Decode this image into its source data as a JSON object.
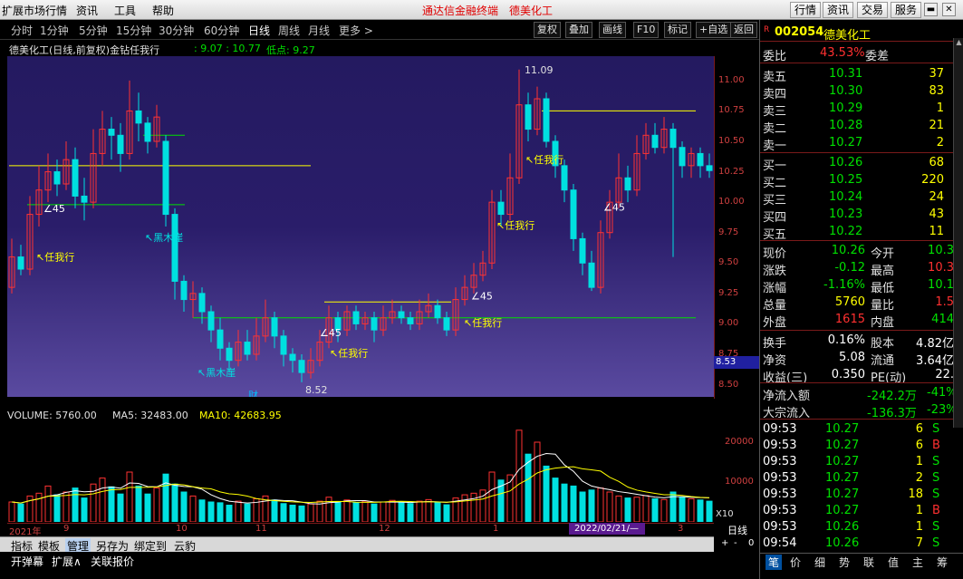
{
  "menubar": {
    "items": [
      "扩展市场行情",
      "资讯",
      "工具",
      "帮助"
    ],
    "app_title": "通达信金融终端",
    "stock_title": "德美化工",
    "right_buttons": [
      "行情",
      "资讯",
      "交易",
      "服务"
    ]
  },
  "periodbar": {
    "periods": [
      "分时",
      "1分钟",
      "5分钟",
      "15分钟",
      "30分钟",
      "60分钟",
      "日线",
      "周线",
      "月线",
      "更多 >"
    ],
    "active": "日线",
    "tools": [
      "复权",
      "叠加",
      "画线",
      "F10",
      "标记",
      "+自选",
      "返回"
    ]
  },
  "chart_header": {
    "title": "德美化工(日线,前复权)金钻任我行",
    "range": ": 9.07 : 10.77",
    "low_label": "低点: 9.27"
  },
  "main_chart_labels": {
    "high_tag": "11.09",
    "low_tag": "8.52",
    "cur_price": "8.53",
    "fin_mark": "财",
    "markers": [
      "任我行",
      "黑木崖",
      "任我行",
      "黑木崖",
      "任我行",
      "任我行",
      "任我行",
      "任我行"
    ],
    "angle45": [
      "45",
      "45",
      "45",
      "45"
    ]
  },
  "chart_data": {
    "type": "candlestick",
    "price_axis": {
      "ticks": [
        "11.00",
        "10.75",
        "10.50",
        "10.25",
        "10.00",
        "9.75",
        "9.50",
        "9.25",
        "9.00",
        "8.75",
        "8.50"
      ],
      "ylim": [
        8.4,
        11.2
      ]
    },
    "volume_axis": {
      "ticks": [
        "20000",
        "10000",
        "X10"
      ],
      "ylim": [
        0,
        25000
      ]
    },
    "date_ticks": [
      "2021年",
      "9",
      "10",
      "11",
      "12",
      "1",
      "3"
    ],
    "date_badge": "2022/02/21/—",
    "candles": [
      {
        "o": 9.3,
        "c": 9.55,
        "h": 9.7,
        "l": 9.25
      },
      {
        "o": 9.55,
        "c": 9.45,
        "h": 9.65,
        "l": 9.4
      },
      {
        "o": 9.45,
        "c": 9.9,
        "h": 10.05,
        "l": 9.4
      },
      {
        "o": 9.9,
        "c": 10.1,
        "h": 10.3,
        "l": 9.8
      },
      {
        "o": 10.1,
        "c": 10.25,
        "h": 10.4,
        "l": 10.0
      },
      {
        "o": 10.25,
        "c": 10.15,
        "h": 10.35,
        "l": 10.05
      },
      {
        "o": 10.15,
        "c": 10.35,
        "h": 10.5,
        "l": 10.1
      },
      {
        "o": 10.35,
        "c": 10.05,
        "h": 10.45,
        "l": 9.95
      },
      {
        "o": 10.05,
        "c": 10.0,
        "h": 10.2,
        "l": 9.85
      },
      {
        "o": 10.0,
        "c": 10.4,
        "h": 10.6,
        "l": 9.95
      },
      {
        "o": 10.4,
        "c": 10.6,
        "h": 10.75,
        "l": 10.3
      },
      {
        "o": 10.6,
        "c": 10.55,
        "h": 10.7,
        "l": 10.35
      },
      {
        "o": 10.55,
        "c": 10.4,
        "h": 10.65,
        "l": 10.25
      },
      {
        "o": 10.4,
        "c": 10.75,
        "h": 11.0,
        "l": 10.35
      },
      {
        "o": 10.75,
        "c": 10.65,
        "h": 10.9,
        "l": 10.5
      },
      {
        "o": 10.65,
        "c": 10.5,
        "h": 10.7,
        "l": 10.4
      },
      {
        "o": 10.5,
        "c": 10.7,
        "h": 10.8,
        "l": 10.45
      },
      {
        "o": 10.5,
        "c": 9.9,
        "h": 10.55,
        "l": 9.8
      },
      {
        "o": 9.9,
        "c": 9.35,
        "h": 9.95,
        "l": 9.2
      },
      {
        "o": 9.35,
        "c": 9.2,
        "h": 9.4,
        "l": 9.1
      },
      {
        "o": 9.2,
        "c": 9.25,
        "h": 9.35,
        "l": 9.05
      },
      {
        "o": 9.25,
        "c": 9.1,
        "h": 9.3,
        "l": 9.0
      },
      {
        "o": 9.1,
        "c": 8.95,
        "h": 9.15,
        "l": 8.85
      },
      {
        "o": 8.95,
        "c": 8.8,
        "h": 9.05,
        "l": 8.7
      },
      {
        "o": 8.8,
        "c": 8.7,
        "h": 8.85,
        "l": 8.6
      },
      {
        "o": 8.7,
        "c": 8.85,
        "h": 8.95,
        "l": 8.65
      },
      {
        "o": 8.85,
        "c": 8.75,
        "h": 8.95,
        "l": 8.7
      },
      {
        "o": 8.75,
        "c": 8.9,
        "h": 9.05,
        "l": 8.7
      },
      {
        "o": 8.9,
        "c": 9.05,
        "h": 9.2,
        "l": 8.85
      },
      {
        "o": 9.05,
        "c": 8.9,
        "h": 9.1,
        "l": 8.8
      },
      {
        "o": 8.9,
        "c": 8.75,
        "h": 8.95,
        "l": 8.65
      },
      {
        "o": 8.75,
        "c": 8.7,
        "h": 8.8,
        "l": 8.6
      },
      {
        "o": 8.7,
        "c": 8.6,
        "h": 8.75,
        "l": 8.52
      },
      {
        "o": 8.6,
        "c": 8.7,
        "h": 8.8,
        "l": 8.55
      },
      {
        "o": 8.7,
        "c": 8.85,
        "h": 8.95,
        "l": 8.65
      },
      {
        "o": 8.85,
        "c": 9.05,
        "h": 9.15,
        "l": 8.8
      },
      {
        "o": 9.05,
        "c": 8.95,
        "h": 9.1,
        "l": 8.85
      },
      {
        "o": 8.95,
        "c": 9.1,
        "h": 9.15,
        "l": 8.9
      },
      {
        "o": 9.1,
        "c": 9.0,
        "h": 9.15,
        "l": 8.95
      },
      {
        "o": 9.0,
        "c": 9.05,
        "h": 9.1,
        "l": 8.95
      },
      {
        "o": 9.05,
        "c": 8.95,
        "h": 9.1,
        "l": 8.85
      },
      {
        "o": 8.95,
        "c": 9.05,
        "h": 9.15,
        "l": 8.9
      },
      {
        "o": 9.05,
        "c": 9.1,
        "h": 9.2,
        "l": 9.0
      },
      {
        "o": 9.1,
        "c": 9.05,
        "h": 9.15,
        "l": 9.0
      },
      {
        "o": 9.05,
        "c": 9.0,
        "h": 9.1,
        "l": 8.95
      },
      {
        "o": 9.0,
        "c": 9.1,
        "h": 9.2,
        "l": 8.95
      },
      {
        "o": 9.1,
        "c": 9.15,
        "h": 9.25,
        "l": 9.05
      },
      {
        "o": 9.15,
        "c": 9.05,
        "h": 9.2,
        "l": 9.0
      },
      {
        "o": 9.05,
        "c": 8.95,
        "h": 9.1,
        "l": 8.9
      },
      {
        "o": 8.95,
        "c": 9.2,
        "h": 9.3,
        "l": 8.9
      },
      {
        "o": 9.2,
        "c": 9.3,
        "h": 9.4,
        "l": 9.15
      },
      {
        "o": 9.3,
        "c": 9.4,
        "h": 9.5,
        "l": 9.25
      },
      {
        "o": 9.4,
        "c": 9.5,
        "h": 9.6,
        "l": 9.35
      },
      {
        "o": 9.5,
        "c": 10.0,
        "h": 10.1,
        "l": 9.45
      },
      {
        "o": 10.0,
        "c": 9.9,
        "h": 10.1,
        "l": 9.8
      },
      {
        "o": 9.9,
        "c": 10.2,
        "h": 10.4,
        "l": 9.85
      },
      {
        "o": 10.2,
        "c": 10.8,
        "h": 11.09,
        "l": 10.15
      },
      {
        "o": 10.8,
        "c": 10.6,
        "h": 10.9,
        "l": 10.5
      },
      {
        "o": 10.6,
        "c": 10.85,
        "h": 10.95,
        "l": 10.55
      },
      {
        "o": 10.85,
        "c": 10.5,
        "h": 10.9,
        "l": 10.45
      },
      {
        "o": 10.5,
        "c": 10.3,
        "h": 10.55,
        "l": 10.2
      },
      {
        "o": 10.3,
        "c": 10.1,
        "h": 10.35,
        "l": 10.0
      },
      {
        "o": 10.1,
        "c": 9.7,
        "h": 10.15,
        "l": 9.6
      },
      {
        "o": 9.7,
        "c": 9.5,
        "h": 9.75,
        "l": 9.4
      },
      {
        "o": 9.5,
        "c": 9.3,
        "h": 9.6,
        "l": 9.27
      },
      {
        "o": 9.3,
        "c": 9.75,
        "h": 9.85,
        "l": 9.25
      },
      {
        "o": 9.75,
        "c": 10.0,
        "h": 10.1,
        "l": 9.7
      },
      {
        "o": 10.0,
        "c": 10.2,
        "h": 10.4,
        "l": 9.95
      },
      {
        "o": 10.2,
        "c": 10.1,
        "h": 10.3,
        "l": 10.0
      },
      {
        "o": 10.1,
        "c": 10.4,
        "h": 10.55,
        "l": 10.05
      },
      {
        "o": 10.4,
        "c": 10.55,
        "h": 10.65,
        "l": 10.35
      },
      {
        "o": 10.55,
        "c": 10.45,
        "h": 10.65,
        "l": 10.4
      },
      {
        "o": 10.45,
        "c": 10.6,
        "h": 10.7,
        "l": 10.4
      },
      {
        "o": 10.6,
        "c": 10.45,
        "h": 10.65,
        "l": 9.55
      },
      {
        "o": 10.45,
        "c": 10.3,
        "h": 10.5,
        "l": 10.2
      },
      {
        "o": 10.3,
        "c": 10.4,
        "h": 10.45,
        "l": 10.2
      },
      {
        "o": 10.4,
        "c": 10.3,
        "h": 10.45,
        "l": 10.2
      },
      {
        "o": 10.3,
        "c": 10.26,
        "h": 10.4,
        "l": 10.2
      }
    ],
    "volumes": [
      5000,
      4500,
      6500,
      7200,
      9000,
      6800,
      7500,
      8500,
      6000,
      9500,
      11000,
      8800,
      7000,
      12500,
      9000,
      7000,
      8500,
      12000,
      9500,
      7500,
      6500,
      5500,
      5000,
      4800,
      4200,
      5200,
      4500,
      5800,
      6500,
      5500,
      4600,
      4200,
      4000,
      4500,
      5200,
      6200,
      5000,
      5500,
      4800,
      5200,
      4500,
      5000,
      5400,
      4800,
      4600,
      5200,
      5600,
      4900,
      4300,
      6000,
      6800,
      7200,
      8000,
      12500,
      10500,
      11800,
      23000,
      17000,
      20000,
      14000,
      11000,
      9500,
      9000,
      7500,
      8000,
      8500,
      7500,
      6500,
      6000,
      6200,
      6600,
      5800,
      5600,
      7500,
      6200,
      5800,
      5500,
      5200
    ]
  },
  "volume_header": {
    "volume": "VOLUME: 5760.00",
    "ma5": "MA5: 32483.00",
    "ma10": "MA10: 42683.95"
  },
  "bottom": {
    "tabs": [
      "指标",
      "模板",
      "管理",
      "另存为",
      "绑定到",
      "云豹"
    ],
    "status": [
      "开弹幕",
      "扩展∧",
      "关联报价"
    ],
    "period_label": "日线",
    "zoom": [
      "+",
      "-",
      "0"
    ]
  },
  "quote": {
    "r_mark": "R",
    "code": "002054",
    "name": "德美化工",
    "weibi_label": "委比",
    "weibi": "43.53%",
    "weicha_label": "委差",
    "asks": [
      {
        "label": "卖五",
        "price": "10.31",
        "vol": "37"
      },
      {
        "label": "卖四",
        "price": "10.30",
        "vol": "83"
      },
      {
        "label": "卖三",
        "price": "10.29",
        "vol": "1"
      },
      {
        "label": "卖二",
        "price": "10.28",
        "vol": "21"
      },
      {
        "label": "卖一",
        "price": "10.27",
        "vol": "2"
      }
    ],
    "bids": [
      {
        "label": "买一",
        "price": "10.26",
        "vol": "68"
      },
      {
        "label": "买二",
        "price": "10.25",
        "vol": "220"
      },
      {
        "label": "买三",
        "price": "10.24",
        "vol": "24"
      },
      {
        "label": "买四",
        "price": "10.23",
        "vol": "43"
      },
      {
        "label": "买五",
        "price": "10.22",
        "vol": "11"
      }
    ],
    "stats": [
      {
        "l1": "现价",
        "v1": "10.26",
        "l2": "今开",
        "v2": "10.3"
      },
      {
        "l1": "涨跌",
        "v1": "-0.12",
        "l2": "最高",
        "v2": "10.3"
      },
      {
        "l1": "涨幅",
        "v1": "-1.16%",
        "l2": "最低",
        "v2": "10.1"
      },
      {
        "l1": "总量",
        "v1": "5760",
        "l2": "量比",
        "v2": "1.5"
      },
      {
        "l1": "外盘",
        "v1": "1615",
        "l2": "内盘",
        "v2": "414"
      }
    ],
    "stats2": [
      {
        "l1": "换手",
        "v1": "0.16%",
        "l2": "股本",
        "v2": "4.82亿"
      },
      {
        "l1": "净资",
        "v1": "5.08",
        "l2": "流通",
        "v2": "3.64亿"
      },
      {
        "l1": "收益(三)",
        "v1": "0.350",
        "l2": "PE(动)",
        "v2": "22."
      }
    ],
    "flow": [
      {
        "label": "净流入额",
        "v1": "-242.2万",
        "v2": "-41%"
      },
      {
        "label": "大宗流入",
        "v1": "-136.3万",
        "v2": "-23%"
      }
    ],
    "ticks": [
      {
        "t": "09:53",
        "p": "10.27",
        "v": "6",
        "d": "S"
      },
      {
        "t": "09:53",
        "p": "10.27",
        "v": "6",
        "d": "B"
      },
      {
        "t": "09:53",
        "p": "10.27",
        "v": "1",
        "d": "S"
      },
      {
        "t": "09:53",
        "p": "10.27",
        "v": "2",
        "d": "S"
      },
      {
        "t": "09:53",
        "p": "10.27",
        "v": "18",
        "d": "S"
      },
      {
        "t": "09:53",
        "p": "10.27",
        "v": "1",
        "d": "B"
      },
      {
        "t": "09:53",
        "p": "10.26",
        "v": "1",
        "d": "S"
      },
      {
        "t": "09:54",
        "p": "10.26",
        "v": "7",
        "d": "S"
      }
    ],
    "tabs": [
      "笔",
      "价",
      "细",
      "势",
      "联",
      "值",
      "主",
      "筹"
    ]
  }
}
